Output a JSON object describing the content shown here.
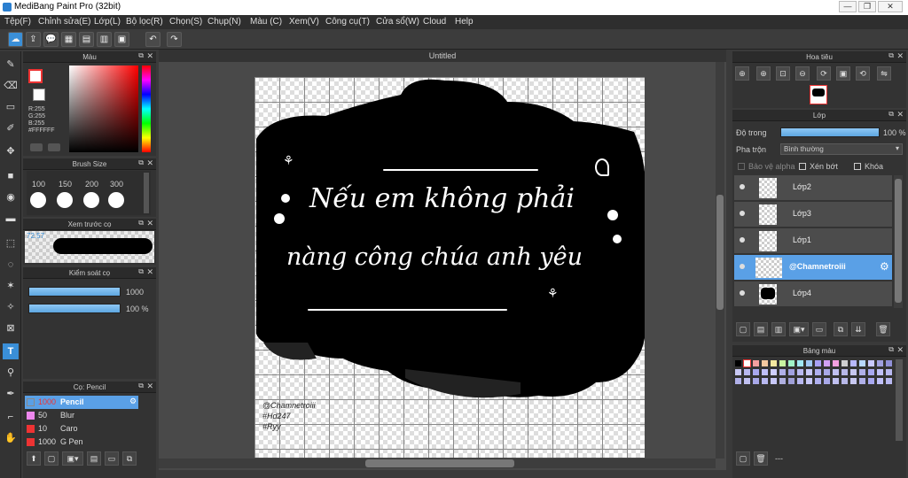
{
  "window": {
    "title": "MediBang Paint Pro (32bit)",
    "min": "—",
    "max": "❐",
    "close": "✕"
  },
  "menu": [
    "Tệp(F)",
    "Chỉnh sửa(E)",
    "Lớp(L)",
    "Bộ lọc(R)",
    "Chọn(S)",
    "Chụp(N)",
    "Màu (C)",
    "Xem(V)",
    "Công cụ(T)",
    "Cửa sổ(W)",
    "Cloud",
    "Help"
  ],
  "toolbar": [
    "☁",
    "⇪",
    "💬",
    "▦",
    "▤",
    "▥",
    "▣"
  ],
  "undo": "↶",
  "redo": "↷",
  "tools": [
    "✎",
    "⌫",
    "▭",
    "✐",
    "✥",
    "■",
    "◉",
    "▬",
    "⬚",
    "◌",
    "✶",
    "✧",
    "⊠",
    "T",
    "⚲",
    "✒",
    "⌐",
    "✋"
  ],
  "color_panel": {
    "title": "Màu",
    "r": "R:255",
    "g": "G:255",
    "b": "B:255",
    "hex": "#FFFFFF"
  },
  "brush_size": {
    "title": "Brush Size",
    "sizes": [
      "100",
      "150",
      "200",
      "300"
    ]
  },
  "brush_preview": {
    "title": "Xem trước cọ",
    "value": "72.57"
  },
  "brush_control": {
    "title": "Kiểm soát cọ",
    "size_value": "1000",
    "opacity_value": "100 %"
  },
  "brush_list": {
    "title": "Cọ: Pencil",
    "items": [
      {
        "size": "1000",
        "name": "Pencil",
        "color": "#222222"
      },
      {
        "size": "50",
        "name": "Blur",
        "color": "#ee88ee"
      },
      {
        "size": "10",
        "name": "Caro",
        "color": "#ee3333"
      },
      {
        "size": "1000",
        "name": "G Pen",
        "color": "#ee3333"
      }
    ]
  },
  "canvas": {
    "tab": "Untitled",
    "line1": "Nếu em không phải",
    "line2": "nàng công chúa anh yêu",
    "credit1": "@Chamnetroiii",
    "credit2": "#Hd247",
    "credit3": "#Ryy"
  },
  "navigator": {
    "title": "Hoa tiêu"
  },
  "layers": {
    "title": "Lớp",
    "opacity_label": "Độ trong",
    "opacity_value": "100 %",
    "blend_label": "Pha trộn",
    "blend_value": "Bình thường",
    "protect_alpha": "Bảo vệ alpha",
    "clipping": "Xén bớt",
    "lock": "Khóa",
    "items": [
      {
        "name": "Lớp2"
      },
      {
        "name": "Lớp3"
      },
      {
        "name": "Lớp1"
      },
      {
        "name": "@Chamnetroiii"
      },
      {
        "name": "Lớp4"
      }
    ]
  },
  "palette": {
    "title": "Bảng màu",
    "footer": "---"
  },
  "colors": {
    "accent": "#3a8fd8",
    "selected_row": "#5aa0e6"
  }
}
